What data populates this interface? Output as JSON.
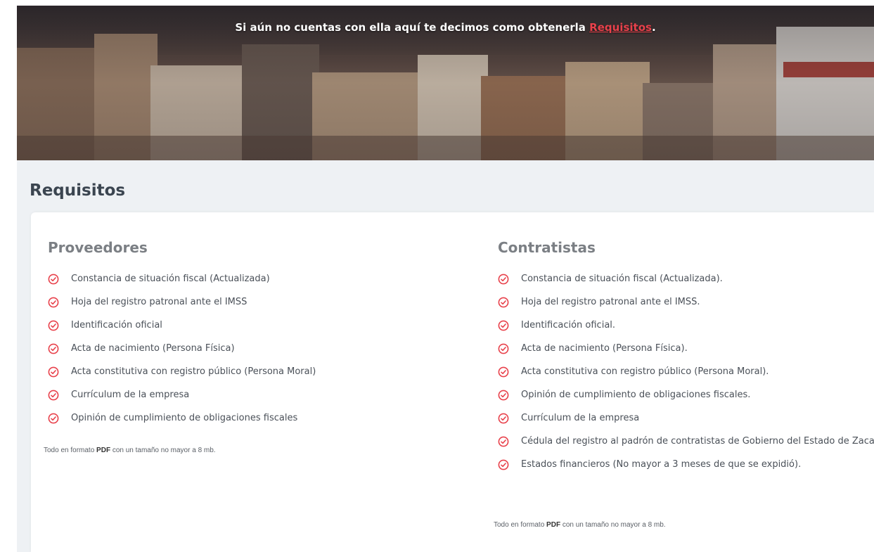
{
  "hero": {
    "text": "Si aún no cuentas con ella aquí te decimos como obtenerla",
    "link": "Requisitos",
    "suffix": "."
  },
  "section": {
    "title": "Requisitos"
  },
  "proveedores": {
    "title": "Proveedores",
    "items": [
      "Constancia de situación fiscal (Actualizada)",
      "Hoja del registro patronal ante el IMSS",
      "Identificación oficial",
      "Acta de nacimiento (Persona Física)",
      "Acta constitutiva con registro público (Persona Moral)",
      "Currículum de la empresa",
      "Opinión de cumplimiento de obligaciones fiscales"
    ],
    "note_prefix": "Todo en formato ",
    "note_bold": "PDF",
    "note_suffix": " con un tamaño no mayor a 8 mb."
  },
  "contratistas": {
    "title": "Contratistas",
    "items": [
      "Constancia de situación fiscal (Actualizada).",
      "Hoja del registro patronal ante el IMSS.",
      "Identificación oficial.",
      "Acta de nacimiento (Persona Física).",
      "Acta constitutiva con registro público (Persona Moral).",
      "Opinión de cumplimiento de obligaciones fiscales.",
      "Currículum de la empresa",
      "Cédula del registro al padrón de contratistas de Gobierno del Estado de Zacatecas",
      "Estados financieros (No mayor a 3 meses de que se expidió)."
    ],
    "note_prefix": "Todo en formato ",
    "note_bold": "PDF",
    "note_suffix": " con un tamaño no mayor a 8 mb."
  },
  "icons": {
    "check": "check-circle-icon"
  },
  "colors": {
    "accent": "#e8414b",
    "section_bg": "#eef1f4",
    "heading": "#3b4550",
    "subheading": "#7b7f84"
  }
}
